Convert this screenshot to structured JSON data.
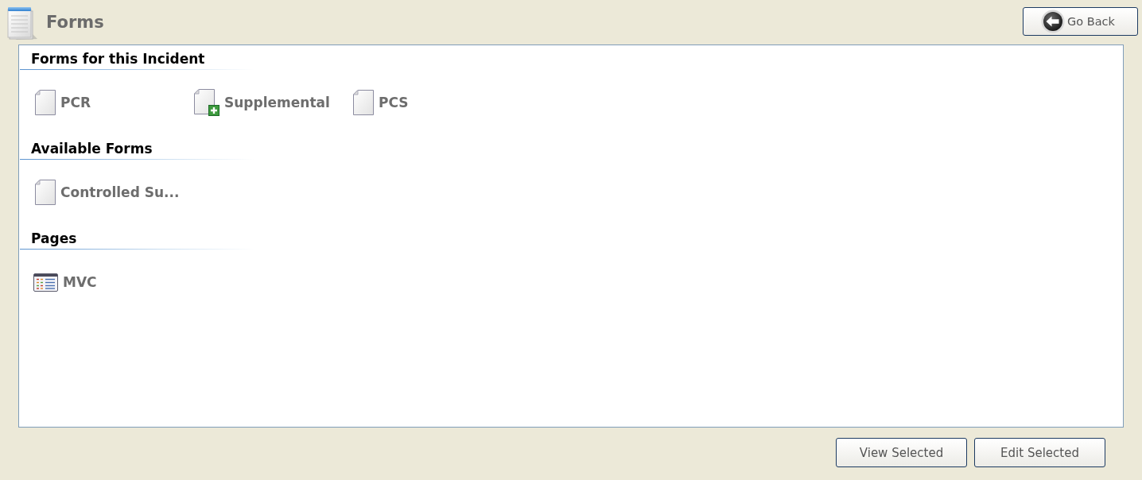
{
  "header": {
    "title": "Forms",
    "back_button": "Go Back"
  },
  "sections": [
    {
      "heading": "Forms for this Incident",
      "items": [
        {
          "label": "PCR",
          "kind": "document",
          "selected": false
        },
        {
          "label": "Supplemental",
          "kind": "document-add",
          "selected": false
        },
        {
          "label": "PCS",
          "kind": "document",
          "selected": false
        }
      ]
    },
    {
      "heading": "Available Forms",
      "items": [
        {
          "label": "Controlled Su...",
          "kind": "document",
          "selected": false
        }
      ]
    },
    {
      "heading": "Pages",
      "items": [
        {
          "label": "MVC",
          "kind": "page",
          "selected": false
        }
      ]
    }
  ],
  "buttons": [
    "View Selected",
    "Edit Selected"
  ]
}
